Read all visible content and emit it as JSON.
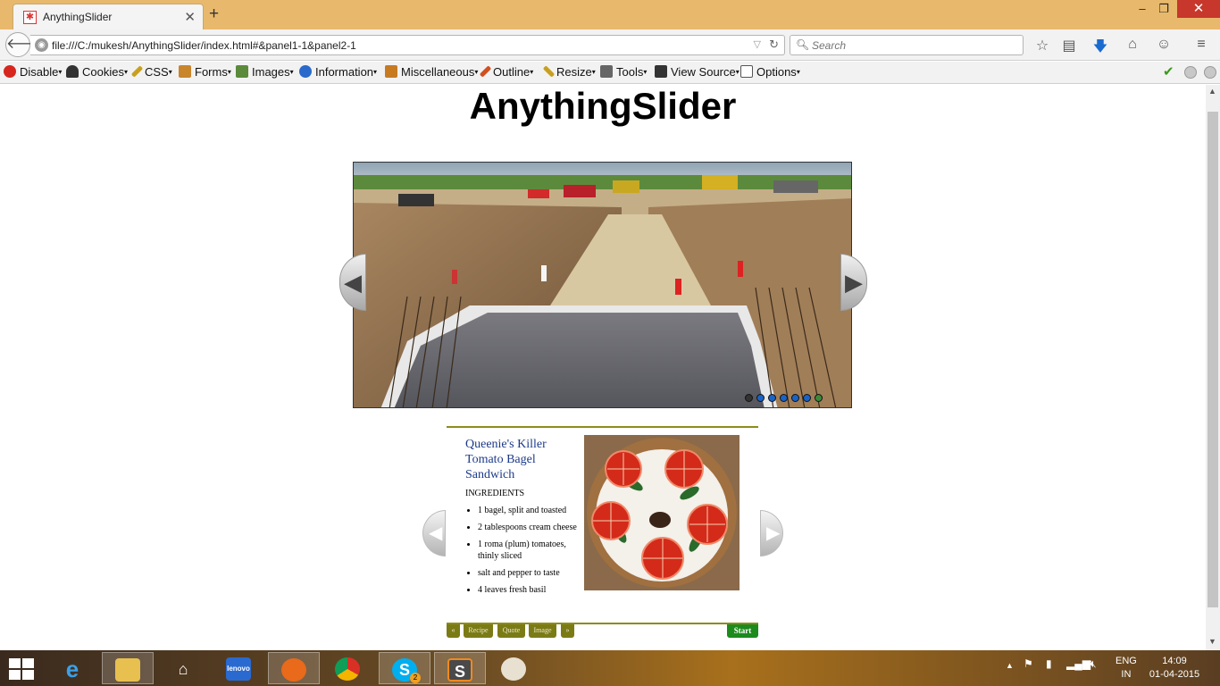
{
  "browser": {
    "tab_title": "AnythingSlider",
    "new_tab": "+",
    "tab_close": "✕",
    "url": "file:///C:/mukesh/AnythingSlider/index.html#&panel1-1&panel2-1",
    "search_placeholder": "Search",
    "window_min": "‒",
    "window_max": "❐",
    "window_close": "✕"
  },
  "dev_toolbar": {
    "items": [
      {
        "label": "Disable",
        "icon": "no-entry-icon",
        "color": "#d7261e"
      },
      {
        "label": "Cookies",
        "icon": "person-icon",
        "color": "#333333"
      },
      {
        "label": "CSS",
        "icon": "pencil-icon",
        "color": "#c8a020"
      },
      {
        "label": "Forms",
        "icon": "clipboard-icon",
        "color": "#c8852a"
      },
      {
        "label": "Images",
        "icon": "picture-icon",
        "color": "#5a8a3a"
      },
      {
        "label": "Information",
        "icon": "info-icon",
        "color": "#2a6acb"
      },
      {
        "label": "Miscellaneous",
        "icon": "book-icon",
        "color": "#c87a20"
      },
      {
        "label": "Outline",
        "icon": "pen-icon",
        "color": "#d05020"
      },
      {
        "label": "Resize",
        "icon": "ruler-icon",
        "color": "#c8a020"
      },
      {
        "label": "Tools",
        "icon": "wrench-icon",
        "color": "#666666"
      },
      {
        "label": "View Source",
        "icon": "monitor-icon",
        "color": "#333333"
      },
      {
        "label": "Options",
        "icon": "options-icon",
        "color": "#555555"
      }
    ]
  },
  "page": {
    "title": "AnythingSlider"
  },
  "slider1": {
    "prev_arrow": "◀",
    "next_arrow": "▶",
    "panel_count": 7,
    "current_panel": 7
  },
  "slider2": {
    "prev_arrow": "◀",
    "next_arrow": "▶",
    "recipe_title": "Queenie's Killer Tomato Bagel Sandwich",
    "ingredients_label": "INGREDIENTS",
    "ingredients": [
      "1 bagel, split and toasted",
      "2 tablespoons cream cheese",
      "1 roma (plum) tomatoes, thinly sliced",
      "salt and pepper to taste",
      "4 leaves fresh basil"
    ],
    "nav": {
      "back": "«",
      "recipe": "Recipe",
      "quote": "Quote",
      "image": "Image",
      "forward": "»",
      "start": "Start"
    }
  },
  "taskbar": {
    "language": "ENG",
    "region": "IN",
    "time": "14:09",
    "date": "01-04-2015",
    "skype_badge": "2"
  }
}
